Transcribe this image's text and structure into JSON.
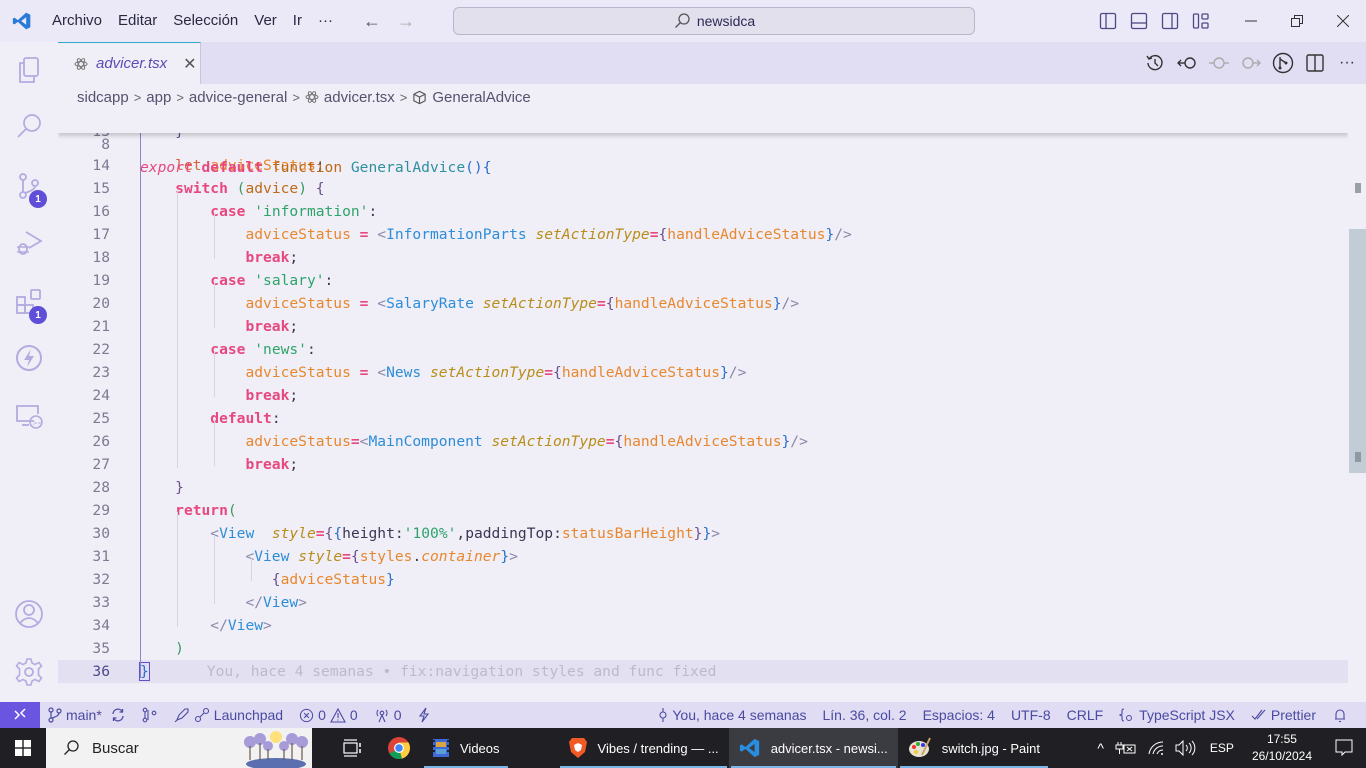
{
  "titlebar": {
    "menu": [
      "Archivo",
      "Editar",
      "Selección",
      "Ver",
      "Ir",
      "···"
    ],
    "command_center": "newsidca",
    "layout_buttons": [
      "toggle-primary-sidebar",
      "toggle-panel",
      "toggle-secondary-sidebar",
      "customize-layout"
    ],
    "window_buttons": [
      "minimize",
      "restore",
      "close"
    ]
  },
  "activitybar": {
    "items": [
      {
        "name": "explorer",
        "badge": null
      },
      {
        "name": "search",
        "badge": null
      },
      {
        "name": "source-control",
        "badge": "1"
      },
      {
        "name": "run-and-debug",
        "badge": null
      },
      {
        "name": "extensions",
        "badge": "1"
      },
      {
        "name": "thunder-client",
        "badge": null
      },
      {
        "name": "remote-explorer",
        "badge": null
      }
    ],
    "bottom": [
      "accounts",
      "manage"
    ]
  },
  "tabs": [
    {
      "label": "advicer.tsx",
      "active": true,
      "italic": true
    }
  ],
  "breadcrumb": [
    "sidcapp",
    "app",
    "advice-general",
    "advicer.tsx",
    "GeneralAdvice"
  ],
  "editor": {
    "sticky_line": {
      "number": "8",
      "text": "export default function GeneralAdvice(){"
    },
    "lines": [
      {
        "n": "13",
        "text": "    }"
      },
      {
        "n": "14",
        "text": "    let adviceStatus;"
      },
      {
        "n": "15",
        "text": "    switch (advice) {"
      },
      {
        "n": "16",
        "text": "        case 'information':"
      },
      {
        "n": "17",
        "text": "            adviceStatus = <InformationParts setActionType={handleAdviceStatus}/>"
      },
      {
        "n": "18",
        "text": "            break;"
      },
      {
        "n": "19",
        "text": "        case 'salary':"
      },
      {
        "n": "20",
        "text": "            adviceStatus = <SalaryRate setActionType={handleAdviceStatus}/>"
      },
      {
        "n": "21",
        "text": "            break;"
      },
      {
        "n": "22",
        "text": "        case 'news':"
      },
      {
        "n": "23",
        "text": "            adviceStatus = <News setActionType={handleAdviceStatus}/>"
      },
      {
        "n": "24",
        "text": "            break;"
      },
      {
        "n": "25",
        "text": "        default:"
      },
      {
        "n": "26",
        "text": "            adviceStatus=<MainComponent setActionType={handleAdviceStatus}/>"
      },
      {
        "n": "27",
        "text": "            break;"
      },
      {
        "n": "28",
        "text": "    }"
      },
      {
        "n": "29",
        "text": "    return("
      },
      {
        "n": "30",
        "text": "        <View  style={{height:'100%',paddingTop:statusBarHeight}}>"
      },
      {
        "n": "31",
        "text": "            <View style={styles.container}>"
      },
      {
        "n": "32",
        "text": "               {adviceStatus}"
      },
      {
        "n": "33",
        "text": "            </View>"
      },
      {
        "n": "34",
        "text": "        </View>"
      },
      {
        "n": "35",
        "text": "    )"
      },
      {
        "n": "36",
        "text": "}"
      }
    ],
    "blame_inline": "You, hace 4 semanas • fix:navigation styles and func fixed",
    "current_line": "36"
  },
  "statusbar": {
    "branch": "main*",
    "launchpad": "Launchpad",
    "errors": "0",
    "warnings": "0",
    "ports": "0",
    "blame": "You, hace 4 semanas",
    "cursor": "Lín. 36, col. 2",
    "indent": "Espacios: 4",
    "encoding": "UTF-8",
    "eol": "CRLF",
    "language": "TypeScript JSX",
    "formatter": "Prettier"
  },
  "taskbar": {
    "search_label": "Buscar",
    "apps": [
      {
        "label": "Videos",
        "icon": "film-icon"
      },
      {
        "label": "Vibes / trending — ...",
        "icon": "brave-icon"
      },
      {
        "label": "advicer.tsx - newsi...",
        "icon": "vscode-icon",
        "active": true
      },
      {
        "label": "switch.jpg - Paint",
        "icon": "paint-icon"
      }
    ],
    "language": "ESP",
    "time": "17:55",
    "date": "26/10/2024"
  },
  "colors": {
    "accent": "#6955e0",
    "statusbar_bg": "#dfdcf3",
    "editor_bg": "#f0eff7",
    "keyword": "#e6487f",
    "variable": "#e8872e",
    "string": "#2ea36a",
    "component": "#2d8dd8"
  }
}
